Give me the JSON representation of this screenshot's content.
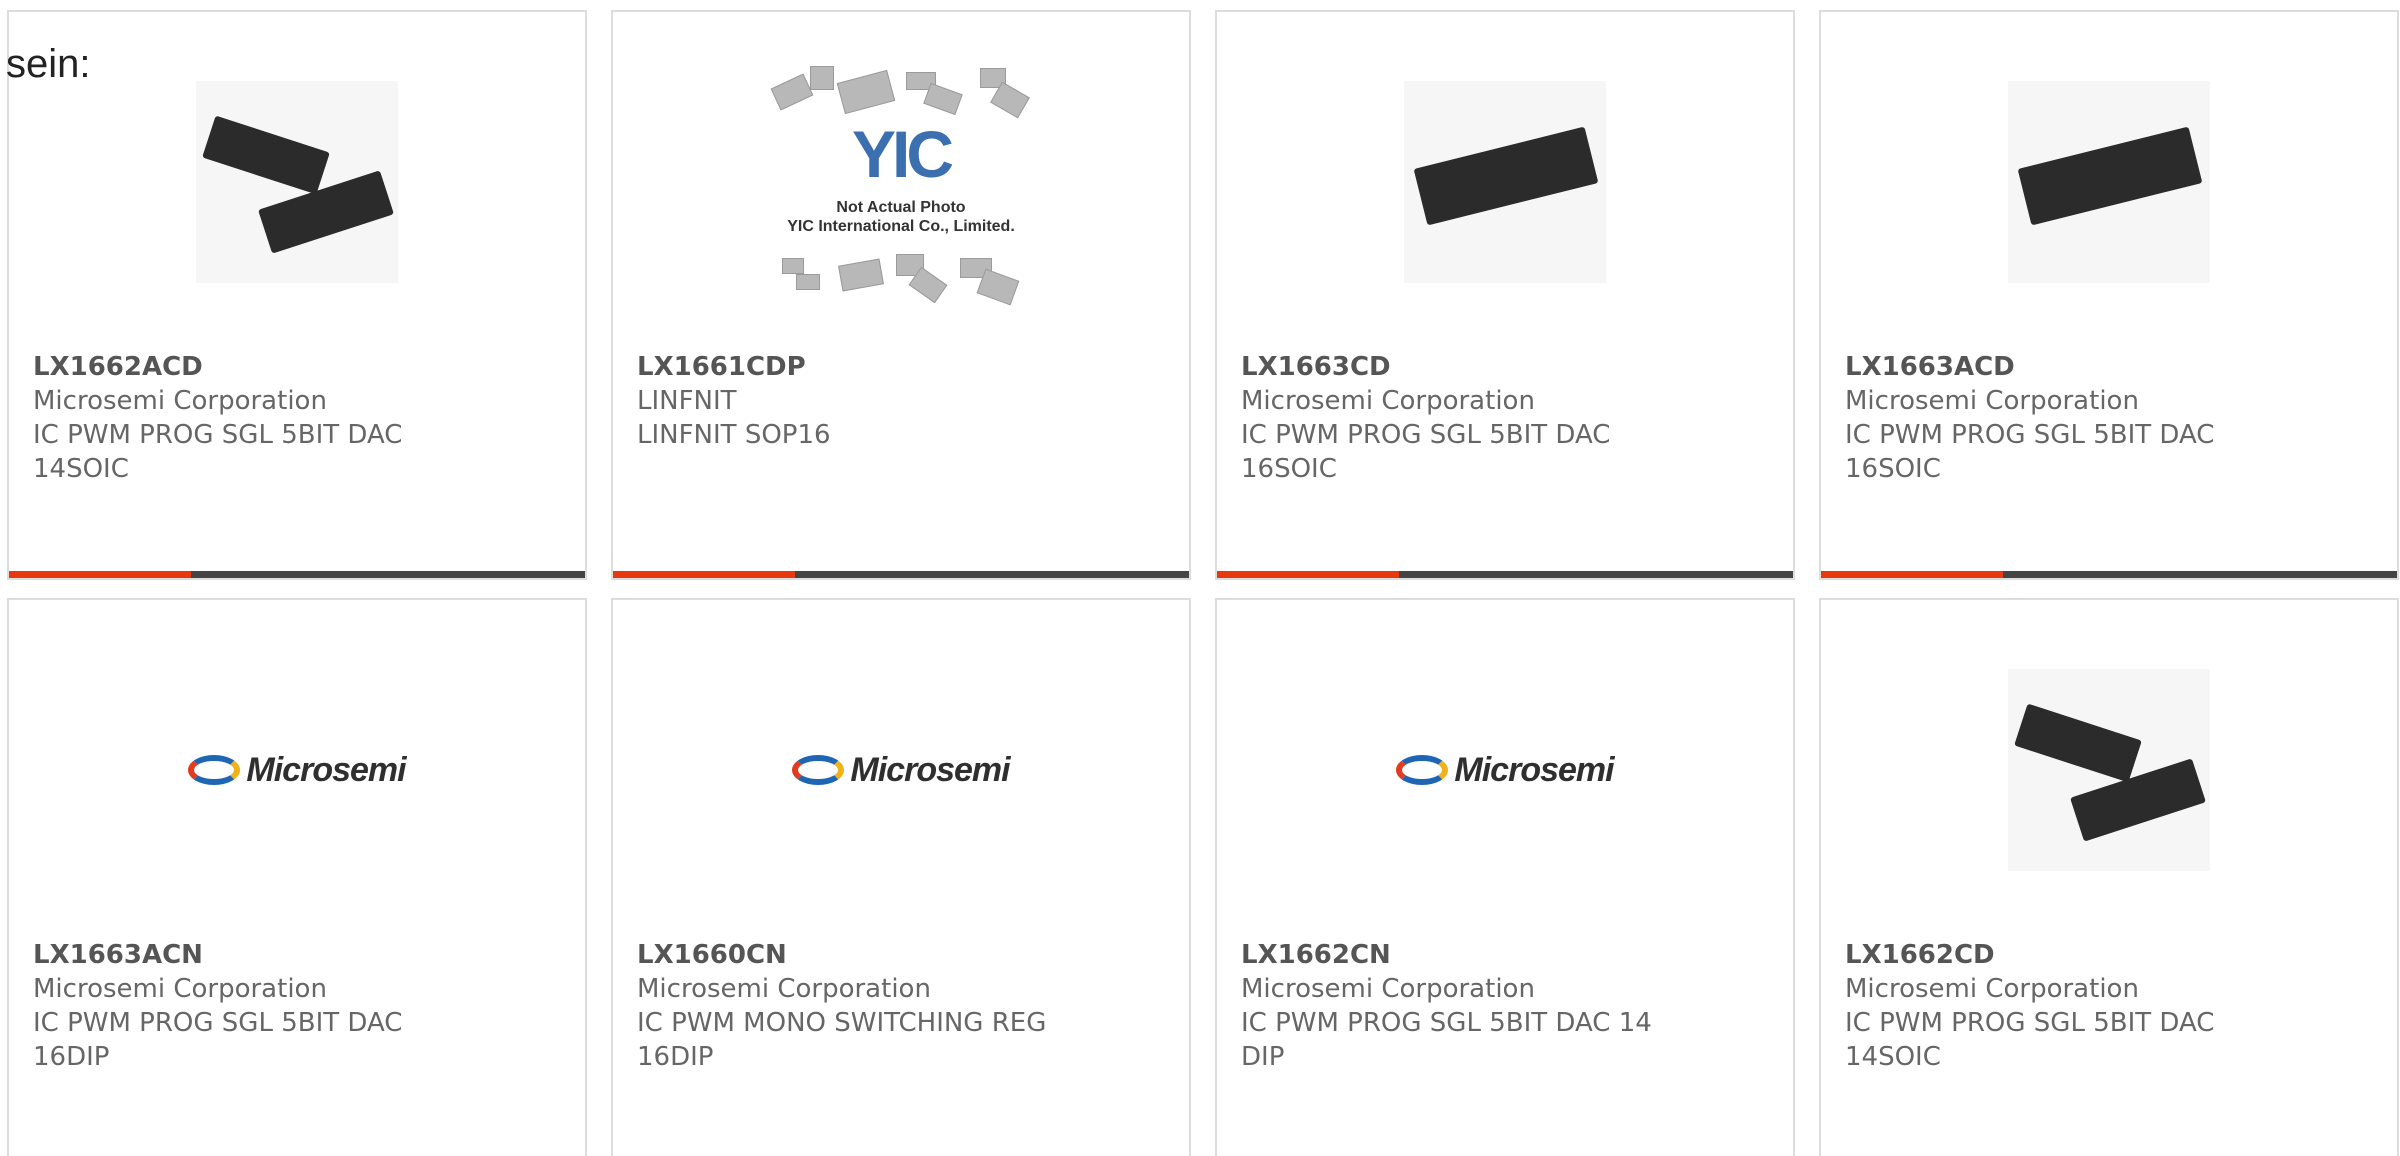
{
  "intro_text": "sein:",
  "image_texts": {
    "yic_mark": "YIC",
    "yic_note_1": "Not Actual Photo",
    "yic_note_2": "YIC International Co., Limited.",
    "logo_brand": "Microsemi"
  },
  "colors": {
    "accent": "#e8380d",
    "bar": "#444444",
    "text": "#666666",
    "border": "#dddddd"
  },
  "products": [
    {
      "part": "LX1662ACD",
      "maker": "Microsemi Corporation",
      "desc": "IC PWM PROG SGL 5BIT DAC 14SOIC",
      "image": "soic-chip-pair-photo"
    },
    {
      "part": "LX1661CDP",
      "maker": "LINFNIT",
      "desc": "LINFNIT SOP16",
      "image": "yic-placeholder-photo"
    },
    {
      "part": "LX1663CD",
      "maker": "Microsemi Corporation",
      "desc": "IC PWM PROG SGL 5BIT DAC 16SOIC",
      "image": "soic16-chip-photo"
    },
    {
      "part": "LX1663ACD",
      "maker": "Microsemi Corporation",
      "desc": "IC PWM PROG SGL 5BIT DAC 16SOIC",
      "image": "soic16-chip-photo"
    },
    {
      "part": "LX1663ACN",
      "maker": "Microsemi Corporation",
      "desc": "IC PWM PROG SGL 5BIT DAC 16DIP",
      "image": "microsemi-logo"
    },
    {
      "part": "LX1660CN",
      "maker": "Microsemi Corporation",
      "desc": "IC PWM MONO SWITCHING REG 16DIP",
      "image": "microsemi-logo"
    },
    {
      "part": "LX1662CN",
      "maker": "Microsemi Corporation",
      "desc": "IC PWM PROG SGL 5BIT DAC 14 DIP",
      "image": "microsemi-logo"
    },
    {
      "part": "LX1662CD",
      "maker": "Microsemi Corporation",
      "desc": "IC PWM PROG SGL 5BIT DAC 14SOIC",
      "image": "soic-chip-pair-photo"
    }
  ]
}
